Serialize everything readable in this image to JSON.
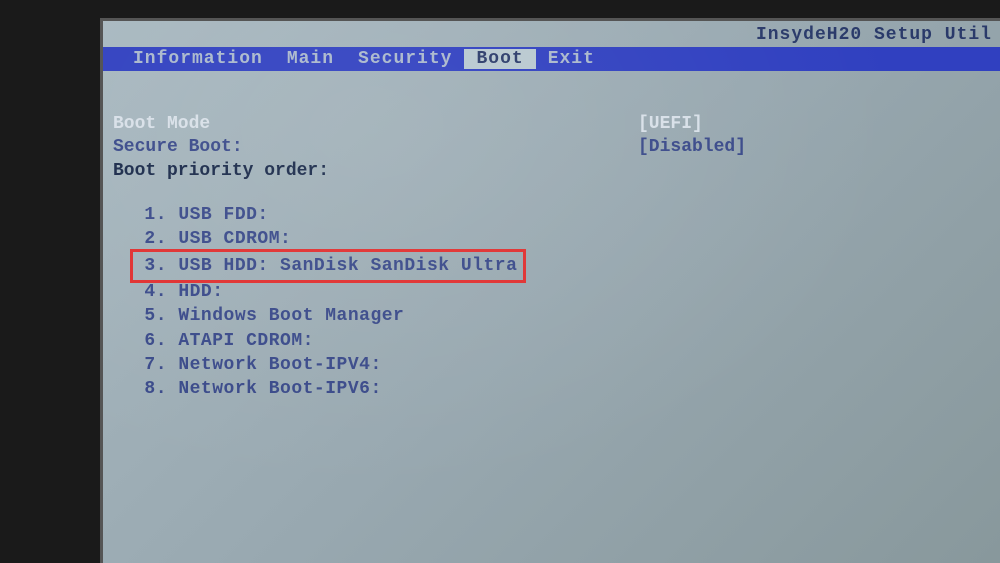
{
  "title": "InsydeH20 Setup Util",
  "menu": {
    "items": [
      "Information",
      "Main",
      "Security",
      "Boot",
      "Exit"
    ],
    "active_index": 3
  },
  "settings": [
    {
      "label": "Boot Mode",
      "value": "[UEFI]",
      "label_style": "bright",
      "value_style": "bright"
    },
    {
      "label": "Secure Boot:",
      "value": "[Disabled]",
      "label_style": "dim",
      "value_style": "dim"
    },
    {
      "label": "Boot priority order:",
      "value": "",
      "label_style": "dark",
      "value_style": ""
    }
  ],
  "boot_order": [
    {
      "num": "1.",
      "text": "USB FDD:",
      "highlighted": false
    },
    {
      "num": "2.",
      "text": "USB CDROM:",
      "highlighted": false
    },
    {
      "num": "3.",
      "text": "USB HDD: SanDisk SanDisk Ultra",
      "highlighted": true
    },
    {
      "num": "4.",
      "text": "HDD:",
      "highlighted": false
    },
    {
      "num": "5.",
      "text": "Windows Boot Manager",
      "highlighted": false
    },
    {
      "num": "6.",
      "text": "ATAPI CDROM:",
      "highlighted": false
    },
    {
      "num": "7.",
      "text": "Network Boot-IPV4:",
      "highlighted": false
    },
    {
      "num": "8.",
      "text": "Network Boot-IPV6:",
      "highlighted": false
    }
  ]
}
